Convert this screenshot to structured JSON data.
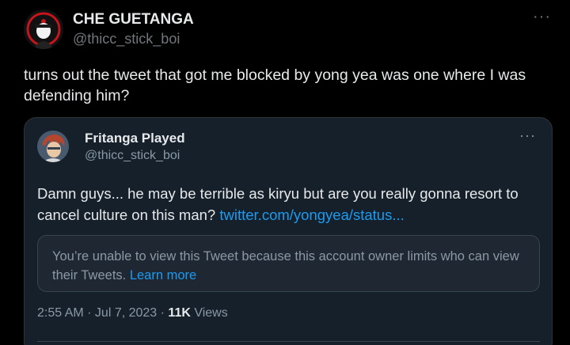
{
  "tweet": {
    "display_name": "CHE GUETANGA",
    "handle": "@thicc_stick_boi",
    "more_label": "···",
    "text": "turns out the tweet that got me blocked by yong yea was one where I was defending him?"
  },
  "quoted_tweet": {
    "display_name": "Fritanga Played",
    "handle": "@thicc_stick_boi",
    "more_label": "···",
    "text": "Damn guys... he may be terrible as kiryu but are you really gonna resort to cancel culture on this man? ",
    "link_text": "twitter.com/yongyea/status...",
    "notice_text": "You’re unable to view this Tweet because this account owner limits who can view their Tweets. ",
    "notice_link": "Learn more",
    "time": "2:55 AM · Jul 7, 2023 · ",
    "views_count": "11K",
    "views_label": " Views"
  },
  "colors": {
    "background": "#000000",
    "card": "#15202b",
    "link": "#1d9bf0",
    "secondary_text": "#8b98a5"
  }
}
